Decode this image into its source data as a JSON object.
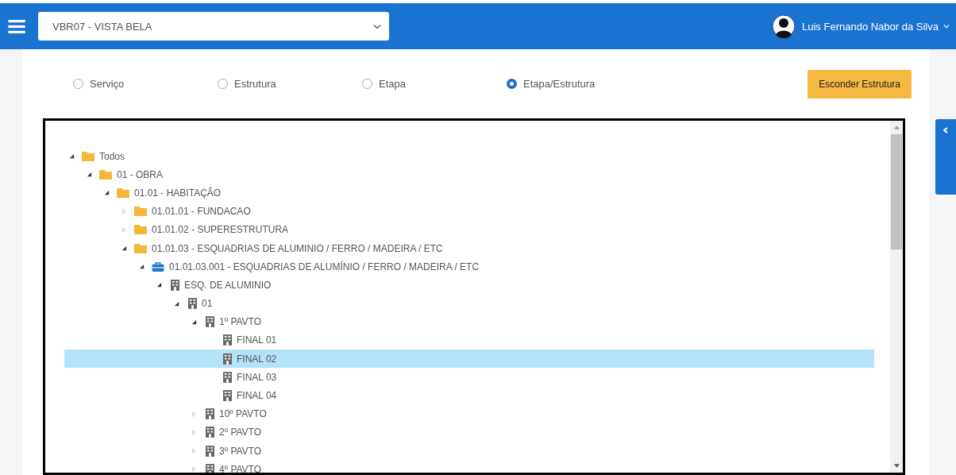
{
  "header": {
    "site_select": {
      "value": "VBR07 - VISTA BELA"
    },
    "user": {
      "name": "Luis Fernando Nabor da Silva"
    }
  },
  "view_options": [
    {
      "label": "Serviço",
      "selected": false
    },
    {
      "label": "Estrutura",
      "selected": false
    },
    {
      "label": "Etapa",
      "selected": false
    },
    {
      "label": "Etapa/Estrutura",
      "selected": true
    }
  ],
  "hide_button": "Esconder Estrutura",
  "tree": [
    {
      "label": "Todos",
      "kind": "folder",
      "expanded": true,
      "selected": false,
      "children": [
        {
          "label": "01 - OBRA",
          "kind": "folder",
          "expanded": true,
          "selected": false,
          "children": [
            {
              "label": "01.01 - HABITAÇÃO",
              "kind": "folder",
              "expanded": true,
              "selected": false,
              "children": [
                {
                  "label": "01.01.01 - FUNDACAO",
                  "kind": "folder",
                  "expanded": false,
                  "selected": false
                },
                {
                  "label": "01.01.02 - SUPERESTRUTURA",
                  "kind": "folder",
                  "expanded": false,
                  "selected": false
                },
                {
                  "label": "01.01.03 - ESQUADRIAS DE ALUMINIO / FERRO / MADEIRA / ETC",
                  "kind": "folder",
                  "expanded": true,
                  "selected": false,
                  "children": [
                    {
                      "label": "01.01.03.001 - ESQUADRIAS DE ALUMÍNIO / FERRO / MADEIRA / ETC",
                      "kind": "briefcase",
                      "expanded": true,
                      "selected": false,
                      "children": [
                        {
                          "label": "ESQ. DE ALUMINIO",
                          "kind": "building",
                          "expanded": true,
                          "selected": false,
                          "children": [
                            {
                              "label": "01",
                              "kind": "building",
                              "expanded": true,
                              "selected": false,
                              "children": [
                                {
                                  "label": "1º PAVTO",
                                  "kind": "building",
                                  "expanded": true,
                                  "selected": false,
                                  "children": [
                                    {
                                      "label": "FINAL 01",
                                      "kind": "building",
                                      "selected": false
                                    },
                                    {
                                      "label": "FINAL 02",
                                      "kind": "building",
                                      "selected": true
                                    },
                                    {
                                      "label": "FINAL 03",
                                      "kind": "building",
                                      "selected": false
                                    },
                                    {
                                      "label": "FINAL 04",
                                      "kind": "building",
                                      "selected": false
                                    }
                                  ]
                                },
                                {
                                  "label": "10º PAVTO",
                                  "kind": "building",
                                  "expanded": false,
                                  "selected": false
                                },
                                {
                                  "label": "2º PAVTO",
                                  "kind": "building",
                                  "expanded": false,
                                  "selected": false
                                },
                                {
                                  "label": "3º PAVTO",
                                  "kind": "building",
                                  "expanded": false,
                                  "selected": false
                                },
                                {
                                  "label": "4º PAVTO",
                                  "kind": "building",
                                  "expanded": false,
                                  "selected": false
                                }
                              ]
                            }
                          ]
                        }
                      ]
                    }
                  ]
                }
              ]
            }
          ]
        }
      ]
    }
  ]
}
